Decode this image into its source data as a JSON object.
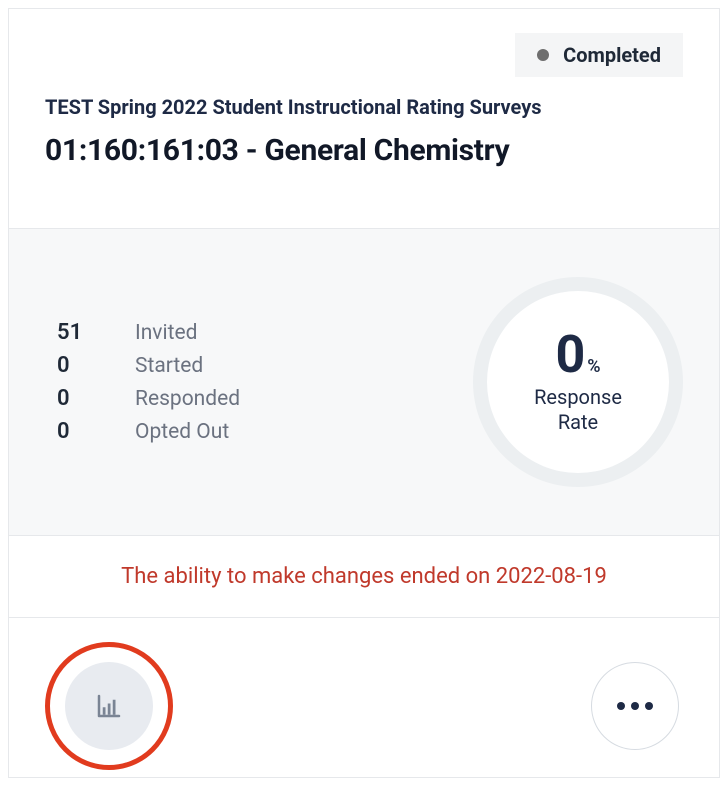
{
  "status": {
    "label": "Completed"
  },
  "survey": {
    "subtitle": "TEST Spring 2022 Student Instructional Rating Surveys",
    "title": "01:160:161:03 - General Chemistry"
  },
  "stats": {
    "invited": {
      "value": "51",
      "label": "Invited"
    },
    "started": {
      "value": "0",
      "label": "Started"
    },
    "responded": {
      "value": "0",
      "label": "Responded"
    },
    "opted_out": {
      "value": "0",
      "label": "Opted Out"
    }
  },
  "response_rate": {
    "value": "0",
    "unit": "%",
    "label_line1": "Response",
    "label_line2": "Rate"
  },
  "notice": {
    "text": "The ability to make changes ended on 2022-08-19"
  }
}
